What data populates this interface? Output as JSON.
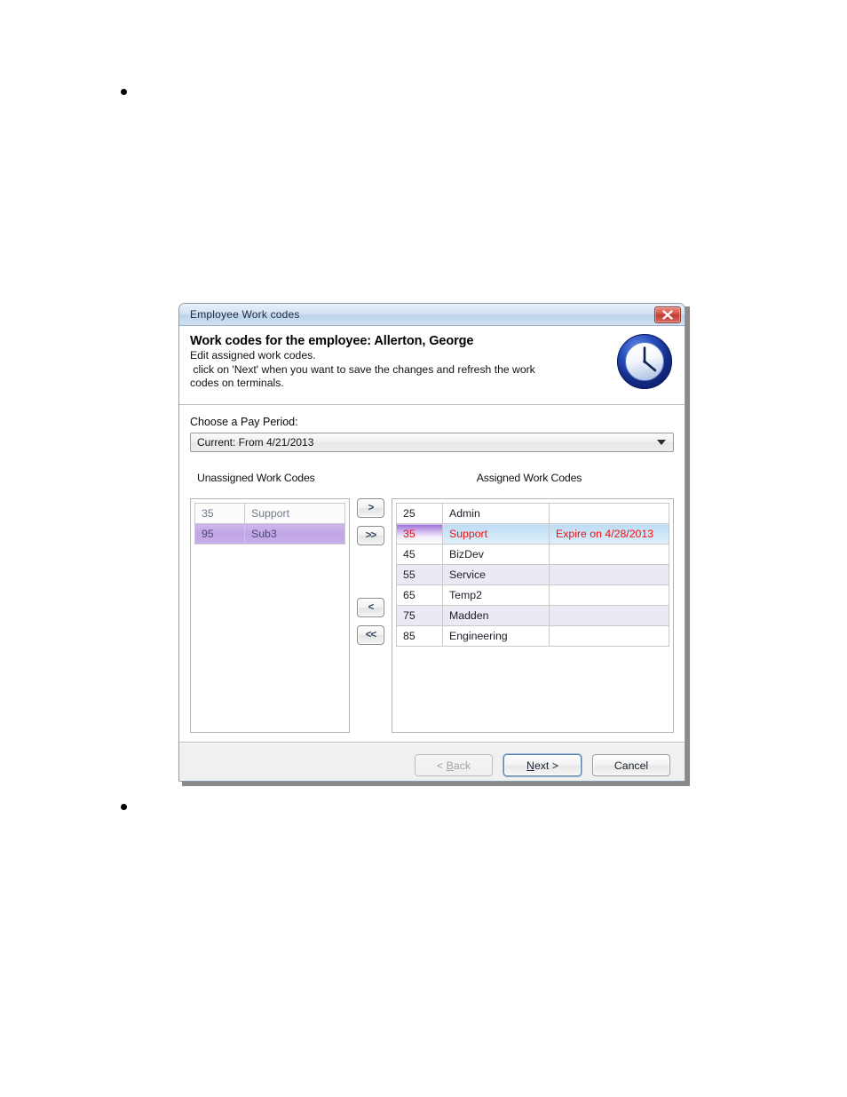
{
  "document": {
    "bullets": [
      "•",
      "•"
    ]
  },
  "dialog": {
    "titlebar": {
      "title": "Employee Work codes",
      "close_label": "Close",
      "close_icon": "close-icon"
    },
    "header": {
      "title": "Work codes for the employee: Allerton, George",
      "line1": "Edit assigned work codes.",
      "line2": " click on 'Next' when you want to save the changes and refresh the work",
      "line3": "codes on terminals.",
      "icon": "clock-icon"
    },
    "pay_period": {
      "label": "Choose a Pay Period:",
      "selected": "Current:  From 4/21/2013",
      "arrow_icon": "chevron-down-icon"
    },
    "lists": {
      "unassigned": {
        "caption": "Unassigned Work Codes",
        "rows": [
          {
            "code": "35",
            "name": "Support",
            "note": "",
            "selected": false
          },
          {
            "code": "95",
            "name": "Sub3",
            "note": "",
            "selected": true
          }
        ]
      },
      "assigned": {
        "caption": "Assigned Work Codes",
        "rows": [
          {
            "code": "25",
            "name": "Admin",
            "note": "",
            "selected": false
          },
          {
            "code": "35",
            "name": "Support",
            "note": "Expire on 4/28/2013",
            "selected": true
          },
          {
            "code": "45",
            "name": "BizDev",
            "note": "",
            "selected": false
          },
          {
            "code": "55",
            "name": "Service",
            "note": "",
            "selected": false
          },
          {
            "code": "65",
            "name": "Temp2",
            "note": "",
            "selected": false
          },
          {
            "code": "75",
            "name": "Madden",
            "note": "",
            "selected": false
          },
          {
            "code": "85",
            "name": "Engineering",
            "note": "",
            "selected": false
          }
        ]
      }
    },
    "transfer_buttons": [
      {
        "key": "assign-one",
        "label": ">",
        "icon": "chevron-right-icon"
      },
      {
        "key": "assign-all",
        "label": ">>",
        "icon": "chevron-double-right-icon"
      },
      {
        "key": "unassign-one",
        "label": "<",
        "icon": "chevron-left-icon"
      },
      {
        "key": "unassign-all",
        "label": "<<",
        "icon": "chevron-double-left-icon"
      }
    ],
    "footer": {
      "back": {
        "label": "< Back",
        "accel": "B",
        "disabled": true
      },
      "next": {
        "label": "Next >",
        "accel": "N",
        "default": true
      },
      "cancel": {
        "label": "Cancel",
        "accel": "",
        "disabled": false
      }
    }
  },
  "colors": {
    "titlebar_blue": "#bcd5ec",
    "close_red": "#c23a2e",
    "selection_purple": "#c0a5e6",
    "selection_blue": "#bcdcf4",
    "expire_red": "#ee1111",
    "clock_blue": "#1b3a9e",
    "footer_gray": "#f0f0f0"
  }
}
